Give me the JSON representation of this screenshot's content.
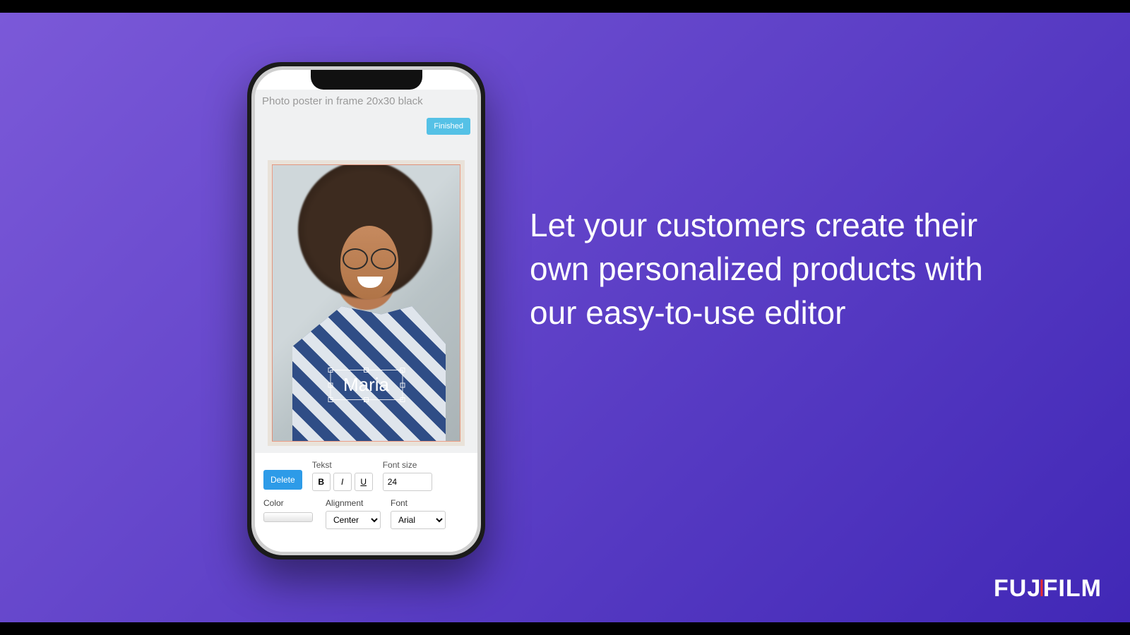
{
  "headline": "Let your customers create their own personalized products with our easy-to-use editor",
  "brand": {
    "left": "FUJ",
    "mid": "I",
    "right": "FILM"
  },
  "app": {
    "title": "Photo poster in frame 20x30 black",
    "finished_label": "Finished",
    "caption_text": "Maria",
    "toolbar": {
      "delete_label": "Delete",
      "text_label": "Tekst",
      "bold": "B",
      "italic": "I",
      "underline": "U",
      "fontsize_label": "Font size",
      "fontsize_value": "24",
      "color_label": "Color",
      "align_label": "Alignment",
      "align_value": "Center",
      "font_label": "Font",
      "font_value": "Arial"
    }
  }
}
